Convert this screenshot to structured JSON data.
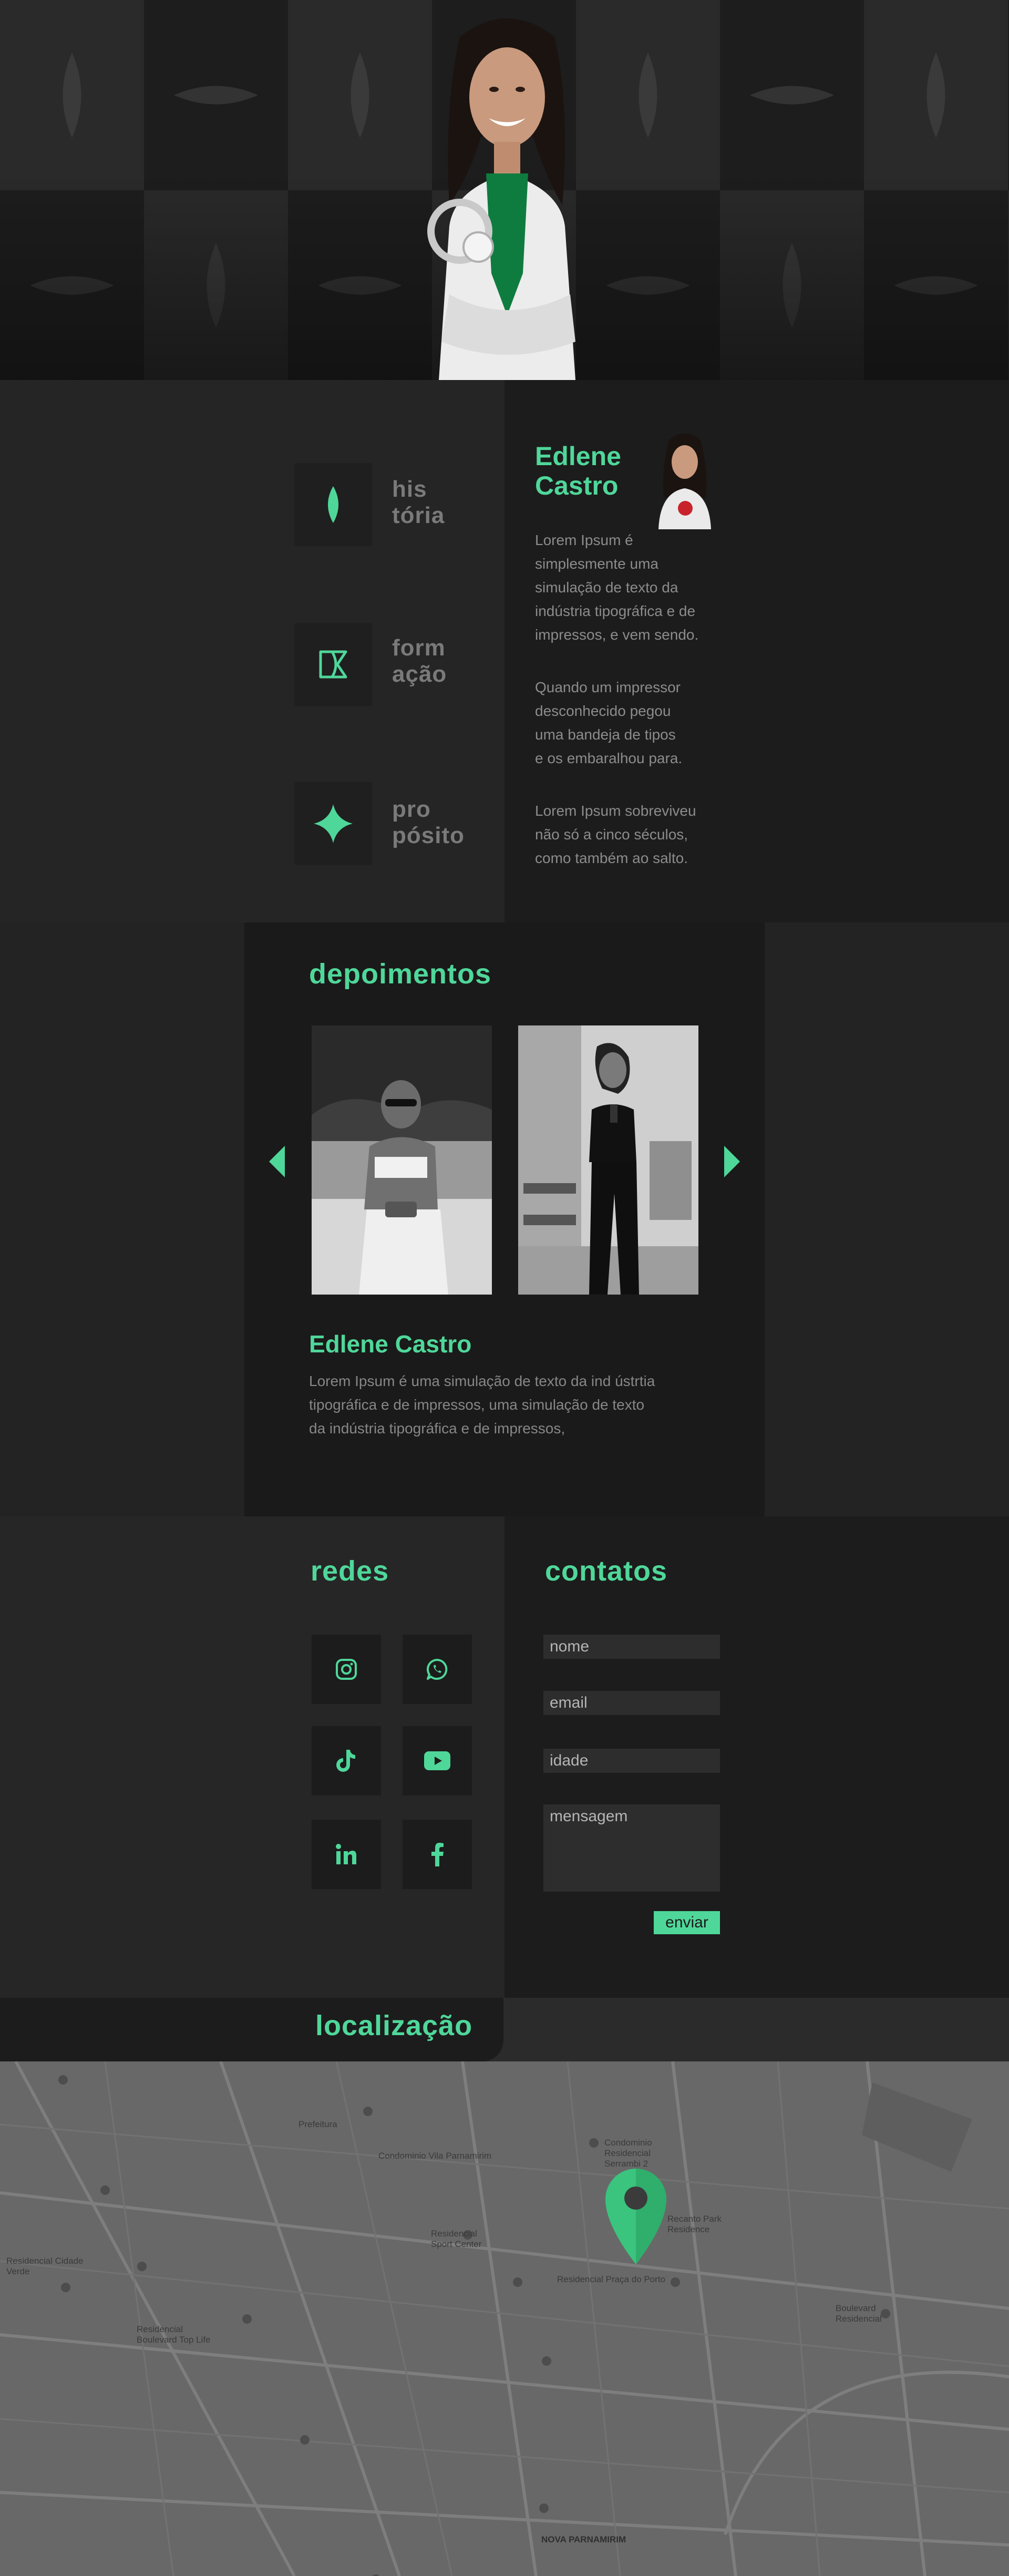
{
  "colors": {
    "accent": "#4fd79a",
    "dark": "#1b1b1b",
    "panel": "#252525"
  },
  "features": [
    {
      "line1": "his",
      "line2": "tória",
      "icon": "leaf-icon"
    },
    {
      "line1": "form",
      "line2": "ação",
      "icon": "book-icon"
    },
    {
      "line1": "pro",
      "line2": "pósito",
      "icon": "sparkle-icon"
    }
  ],
  "about": {
    "name_line1": "Edlene",
    "name_line2": "Castro",
    "paragraphs": [
      [
        "Lorem Ipsum é",
        "simplesmente uma",
        "simulação de texto da",
        "indústria tipográfica e de",
        "impressos, e vem sendo."
      ],
      [
        "Quando um impressor",
        "desconhecido pegou",
        "uma bandeja de tipos",
        "e os embaralhou para."
      ],
      [
        "Lorem Ipsum sobreviveu",
        "não só a cinco séculos,",
        "como também ao salto."
      ]
    ]
  },
  "testimonials": {
    "title": "depoimentos",
    "name": "Edlene Castro",
    "text_lines": [
      "Lorem Ipsum é uma simulação de texto da ind ústrtia",
      "tipográfica e de impressos, uma simulação de texto",
      "da indústria tipográfica e de impressos,"
    ]
  },
  "social": {
    "title": "redes",
    "items": [
      "instagram-icon",
      "whatsapp-icon",
      "tiktok-icon",
      "youtube-icon",
      "linkedin-icon",
      "facebook-icon"
    ]
  },
  "contact": {
    "title": "contatos",
    "fields": {
      "name": "nome",
      "email": "email",
      "age": "idade",
      "message": "mensagem"
    },
    "send_label": "enviar"
  },
  "location": {
    "title": "localização",
    "map_labels": {
      "prefeitura": "Prefeitura",
      "condominio_vila": "Condominio Vila Parnamirim",
      "residencial_serrambi": "Condominio Residencial Serrambi 2",
      "sport_center": "Residencial Sport Center",
      "recanto": "Recanto Park Residence",
      "cidade_verde": "Residencial Cidade Verde",
      "boulevard_top": "Residencial Boulevard Top Life",
      "nova_parnamirim": "NOVA PARNAMIRIM",
      "praca": "Residencial Praça do Porto",
      "boulevard": "Boulevard Residencial"
    }
  }
}
